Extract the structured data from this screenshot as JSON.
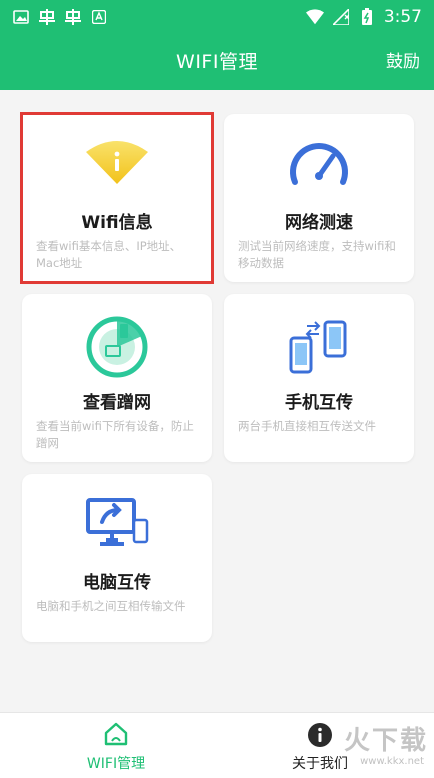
{
  "status_bar": {
    "time": "3:57",
    "icons_left": [
      "image-icon",
      "bug-icon",
      "bug-icon",
      "app-icon"
    ],
    "icons_right": [
      "wifi-icon",
      "signal-icon",
      "battery-icon"
    ]
  },
  "app_bar": {
    "title": "WIFI管理",
    "action_label": "鼓励"
  },
  "cards": [
    {
      "title": "Wifi信息",
      "desc": "查看wifi基本信息、IP地址、Mac地址",
      "icon": "wifi-info-icon",
      "selected": true
    },
    {
      "title": "网络测速",
      "desc": "测试当前网络速度，支持wifi和移动数据",
      "icon": "speedometer-icon",
      "selected": false
    },
    {
      "title": "查看蹭网",
      "desc": "查看当前wifi下所有设备，防止蹭网",
      "icon": "radar-icon",
      "selected": false
    },
    {
      "title": "手机互传",
      "desc": "两台手机直接相互传送文件",
      "icon": "phone-transfer-icon",
      "selected": false
    },
    {
      "title": "电脑互传",
      "desc": "电脑和手机之间互相传输文件",
      "icon": "computer-transfer-icon",
      "selected": false
    }
  ],
  "bottom_nav": {
    "tabs": [
      {
        "label": "WIFI管理",
        "icon": "home-icon",
        "active": true
      },
      {
        "label": "关于我们",
        "icon": "info-icon",
        "active": false
      }
    ]
  },
  "watermark": {
    "text": "火下载",
    "url": "www.kkx.net"
  },
  "colors": {
    "primary": "#1fbf74",
    "selection_border": "#e03a35",
    "icon_blue": "#3b6fd8",
    "icon_yellow": "#f5c91c",
    "icon_green": "#2bc89a"
  }
}
